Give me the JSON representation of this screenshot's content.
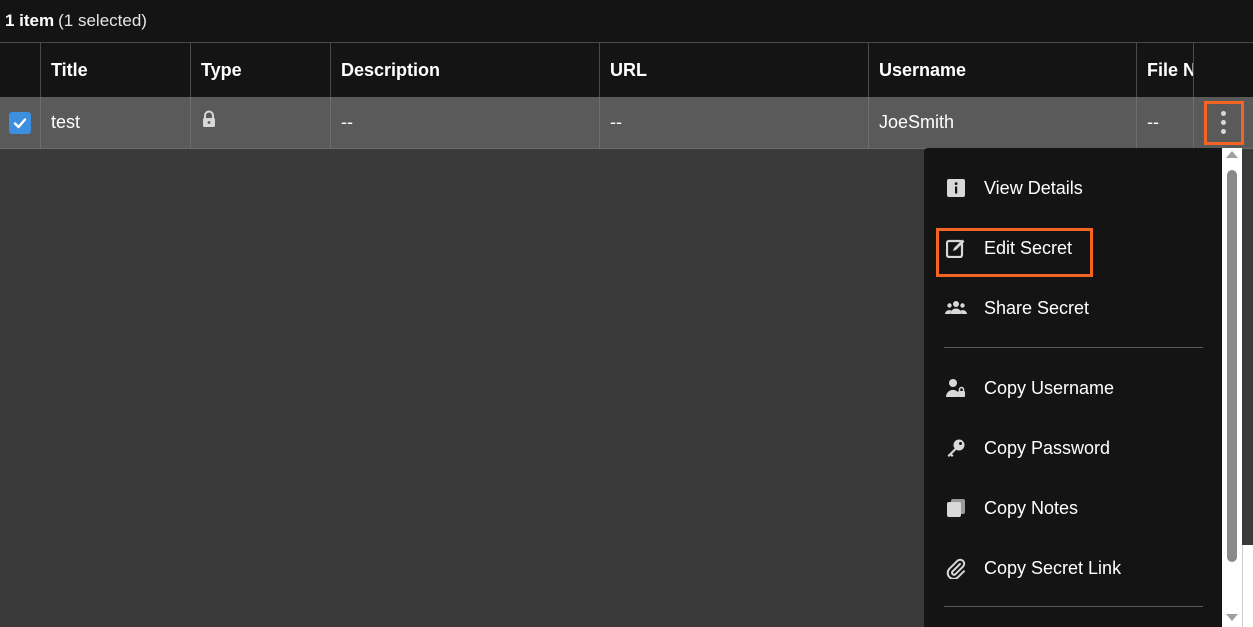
{
  "status": {
    "count": "1 item",
    "selected": "(1 selected)"
  },
  "table": {
    "columns": [
      "Title",
      "Type",
      "Description",
      "URL",
      "Username",
      "File N"
    ],
    "rows": [
      {
        "selected": true,
        "title": "test",
        "type_icon": "lock-icon",
        "description": "--",
        "url": "--",
        "username": "JoeSmith",
        "file": "--"
      }
    ]
  },
  "menu": {
    "items": [
      {
        "label": "View Details",
        "icon": "info-icon"
      },
      {
        "label": "Edit Secret",
        "icon": "edit-icon"
      },
      {
        "label": "Share Secret",
        "icon": "users-icon"
      },
      {
        "label": "Copy Username",
        "icon": "user-lock-icon"
      },
      {
        "label": "Copy Password",
        "icon": "key-icon"
      },
      {
        "label": "Copy Notes",
        "icon": "copy-icon"
      },
      {
        "label": "Copy Secret Link",
        "icon": "paperclip-icon"
      }
    ]
  },
  "colors": {
    "highlight": "#f26522",
    "checkbox": "#3d8fe0",
    "menu_bg": "#141414",
    "row_selected": "#5a5a5a"
  }
}
